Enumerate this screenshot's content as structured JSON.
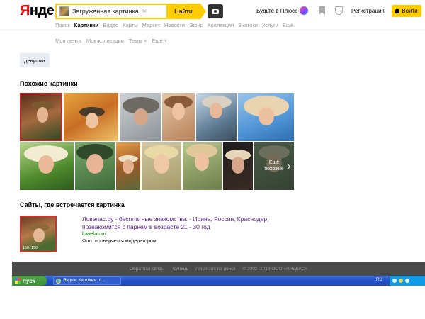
{
  "header": {
    "logo_first": "Я",
    "logo_rest": "ндекс",
    "search_query": "Загруженная картинка",
    "clear_glyph": "×",
    "find_label": "Найти",
    "plus_label": "Будьте в Плюсе",
    "register_label": "Регистрация",
    "login_label": "Войти"
  },
  "tabs": [
    "Поиск",
    "Картинки",
    "Видео",
    "Карты",
    "Маркет",
    "Новости",
    "Эфир",
    "Коллекции",
    "Знатоки",
    "Услуги",
    "Ещё"
  ],
  "active_tab": "Картинки",
  "subtabs": [
    "Моя лента",
    "Мои коллекции",
    "Темы ˅",
    "Ещё ˅"
  ],
  "tag": "девушка",
  "similar": {
    "title": "Похожие картинки",
    "more_line1": "Ещё",
    "more_line2": "похожие"
  },
  "sites": {
    "title": "Сайты, где встречается картинка",
    "thumb_dims": "150×150",
    "result_title": "Ловелас.ру - бесплатные знакомства. - Ирина, Россия, Краснодар, познакомится с парнем в возрасте 21 - 30 год",
    "result_url": "lowelas.ru",
    "result_note": "Фото проверяется модератором"
  },
  "footer": {
    "links": [
      "Обратная связь",
      "Помощь",
      "Лицензия на поиск",
      "© 2002–2019 ООО «ЯНДЕКС»"
    ]
  },
  "taskbar": {
    "start_label": "пуск",
    "window_title": "Яндекс.Картинки: п...",
    "lang": "RU"
  },
  "colors": {
    "accent": "#ffcc00",
    "logo_red": "#ff0000",
    "link_visited": "#551a8b",
    "url_green": "#007700"
  }
}
